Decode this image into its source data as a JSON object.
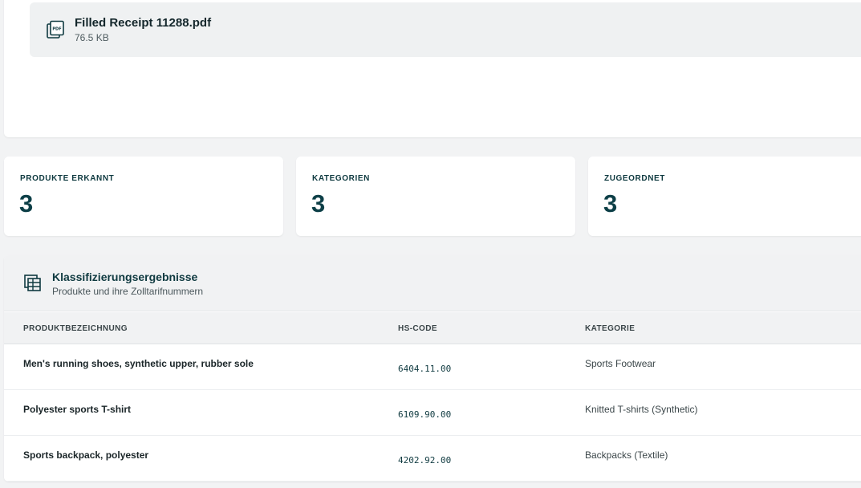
{
  "upload": {
    "file_name": "Filled Receipt 11288.pdf",
    "file_size": "76.5 KB",
    "icon": "pdf-file-icon"
  },
  "stats": [
    {
      "label": "PRODUKTE ERKANNT",
      "value": "3"
    },
    {
      "label": "KATEGORIEN",
      "value": "3"
    },
    {
      "label": "ZUGEORDNET",
      "value": "3"
    }
  ],
  "results": {
    "icon": "table-icon",
    "title": "Klassifizierungsergebnisse",
    "subtitle": "Produkte und ihre Zolltarifnummern",
    "columns": [
      "PRODUKTBEZEICHNUNG",
      "HS-CODE",
      "KATEGORIE"
    ],
    "rows": [
      {
        "name": "Men's running shoes, synthetic upper, rubber sole",
        "hs_code": "6404.11.00",
        "category": "Sports Footwear"
      },
      {
        "name": "Polyester sports T-shirt",
        "hs_code": "6109.90.00",
        "category": "Knitted T-shirts (Synthetic)"
      },
      {
        "name": "Sports backpack, polyester",
        "hs_code": "4202.92.00",
        "category": "Backpacks (Textile)"
      }
    ]
  },
  "colors": {
    "accent": "#0f3a40",
    "background": "#f2f3f4",
    "card": "#ffffff"
  }
}
